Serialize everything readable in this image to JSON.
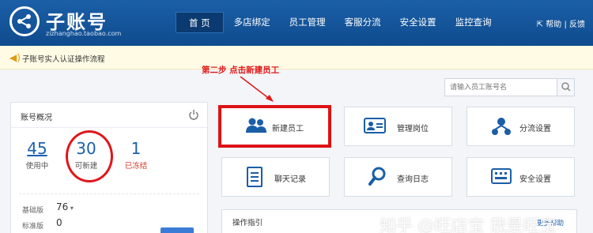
{
  "header": {
    "brand": "子账号",
    "brand_sub": "zizhanghao.taobao.com",
    "nav": [
      "首 页",
      "多店绑定",
      "员工管理",
      "客服分流",
      "安全设置",
      "监控查询"
    ],
    "help": "帮助 | 反馈"
  },
  "notice": {
    "text": "子账号实人认证操作流程"
  },
  "annotation": {
    "step": "第二步    点击新建员工"
  },
  "search": {
    "placeholder": "请输入员工账号名"
  },
  "account": {
    "title": "账号概况",
    "stats": [
      {
        "value": "45",
        "label": "使用中"
      },
      {
        "value": "30",
        "label": "可新建"
      },
      {
        "value": "1",
        "label": "已冻结"
      }
    ],
    "editions": [
      {
        "label": "基础版",
        "value": "76"
      },
      {
        "label": "标准版",
        "value": "0"
      }
    ]
  },
  "tiles": [
    "新建员工",
    "管理岗位",
    "分流设置",
    "聊天记录",
    "查询日志",
    "安全设置"
  ],
  "guide": {
    "title": "操作指引",
    "more": "更多帮助"
  },
  "watermark": "知乎 @旺店宝 我是旺宝",
  "colors": {
    "header": "#1b5fa8",
    "highlight_red": "#dd1216",
    "link_blue": "#1a61ad"
  }
}
